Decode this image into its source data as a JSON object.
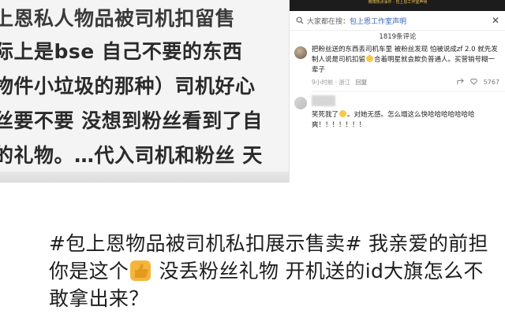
{
  "left_panel": {
    "lines": [
      "上恩私人物品被司机扣留售",
      "际上是bse 自己不要的东西",
      "物件小垃圾的那种）司机好心",
      "丝要不要 没想到粉丝看到了自",
      "的礼物。…代入司机和粉丝 天"
    ]
  },
  "right_panel": {
    "banner": "微博热点事件 · 包上恩工作室声明",
    "search": {
      "prefix": "大家都在搜：",
      "query": "包上恩工作室声明"
    },
    "comment_count": "1819条评论",
    "comments": [
      {
        "text_parts": [
          "把粉丝送的东西丢司机车里 被粉丝发现 怕被说成zf 2.0 就先发制人说是司机扣留",
          "合着明星就会欺负普通人。买营销号糊一辈子"
        ],
        "time": "9小时前 · 浙江",
        "reply": "回复",
        "likes": "5767"
      },
      {
        "text_parts": [
          "笑死我了",
          "。对她无感。怎么塌这么快哈哈哈哈哈哈哈爽！！！！！！！"
        ]
      }
    ]
  },
  "bottom": {
    "text_before": "#包上恩物品被司机私扣展示售卖# 我亲爱的前担你是这个",
    "text_after": " 没丢粉丝礼物 开机送的id大旗怎么不敢拿出来？"
  },
  "icons": {
    "search": "search-icon",
    "close": "close-icon",
    "like": "heart-icon",
    "share": "share-icon",
    "thumb": "thumbs-up-emoji",
    "laugh": "grin-emoji"
  }
}
